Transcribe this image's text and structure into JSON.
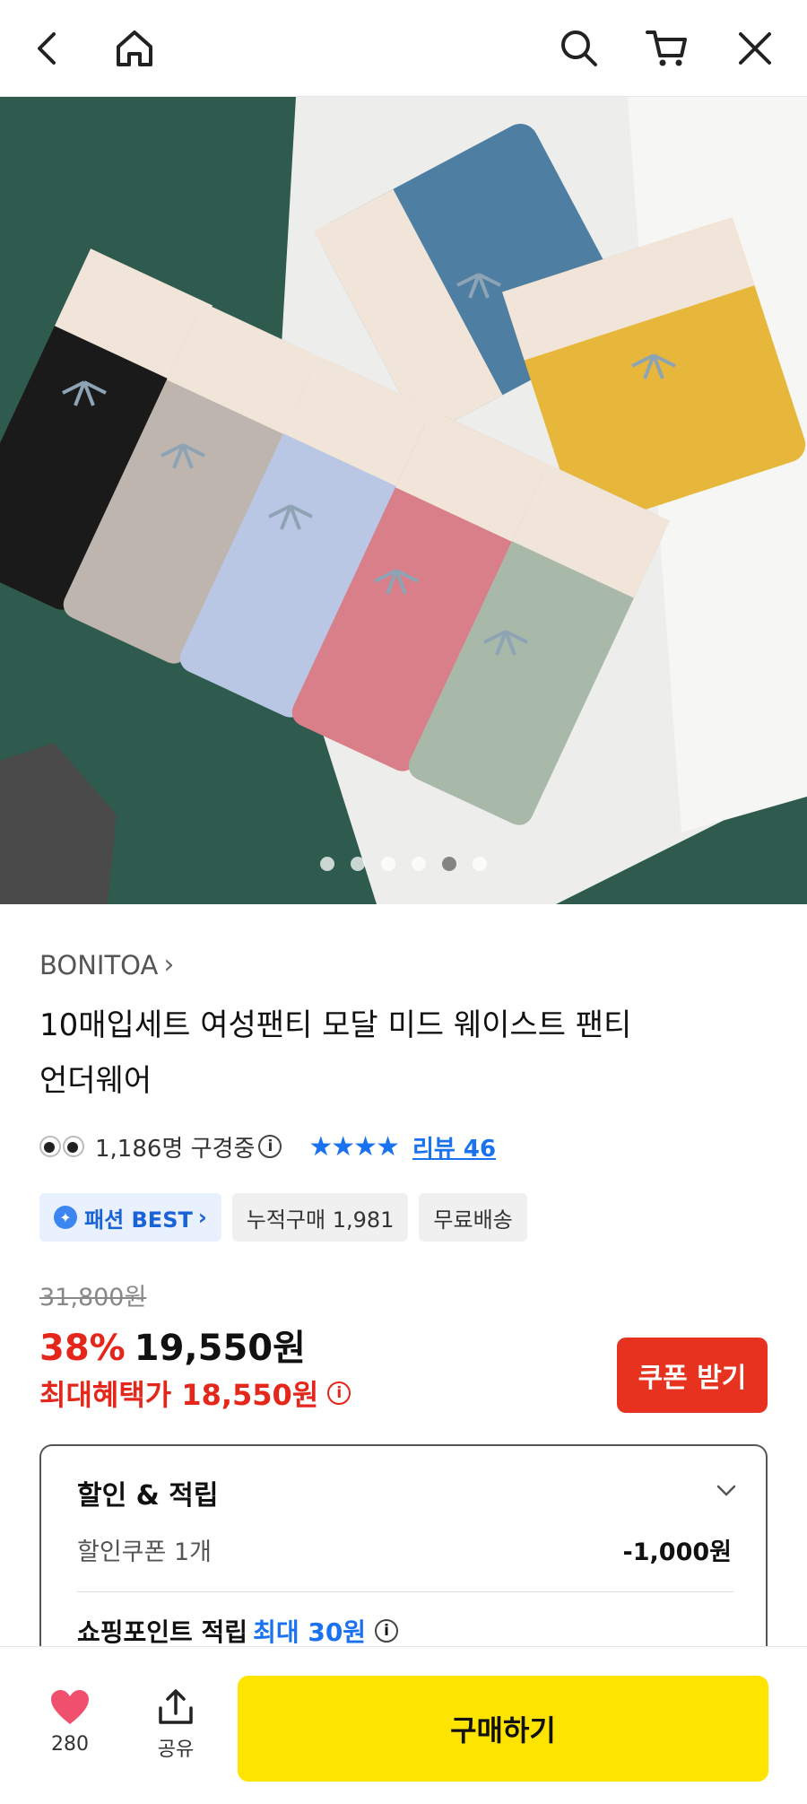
{
  "header": {
    "icons": [
      "back-arrow-icon",
      "home-icon",
      "search-icon",
      "cart-icon",
      "close-icon"
    ]
  },
  "gallery": {
    "image_count": 6,
    "active_index": 4,
    "product_colors": [
      "#1a1a1a",
      "#bdb5ae",
      "#b9c7e4",
      "#d97f8a",
      "#a8b9a9",
      "#4e7fa3",
      "#e7b73b"
    ]
  },
  "product": {
    "brand": "BONITOA",
    "title_line1": "10매입세트 여성팬티 모달 미드 웨이스트 팬티",
    "title_line2": "언더웨어"
  },
  "meta": {
    "viewers": "1,186명 구경중",
    "info_glyph": "i",
    "rating_stars": 4,
    "stars_text": "★★★★",
    "review_text": "리뷰 46"
  },
  "tags": {
    "best": "패션 BEST",
    "purchases": "누적구매 1,981",
    "shipping": "무료배송"
  },
  "price": {
    "original": "31,800원",
    "discount_rate": "38%",
    "sale": "19,550원",
    "max_benefit": "최대혜택가 18,550원",
    "coupon_button": "쿠폰 받기"
  },
  "benefits": {
    "header": "할인 & 적립",
    "coupon_label": "할인쿠폰 1개",
    "coupon_value": "-1,000원",
    "points_label": "쇼핑포인트 적립",
    "points_value": "최대 30원"
  },
  "bottom": {
    "like_count": "280",
    "share_label": "공유",
    "buy_label": "구매하기"
  },
  "colors": {
    "accent_red": "#e5261a",
    "accent_blue": "#1a72f0",
    "buy_yellow": "#ffe400",
    "like_pink": "#f0506e"
  }
}
